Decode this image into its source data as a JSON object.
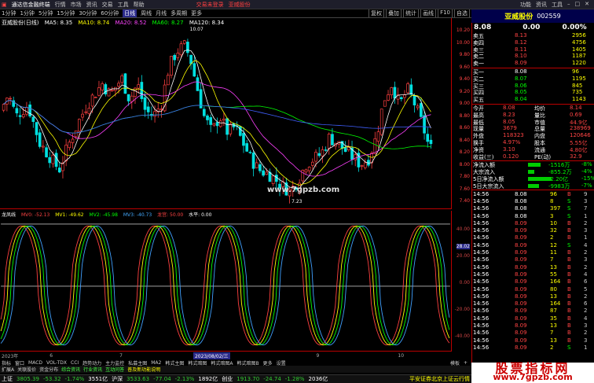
{
  "titlebar": {
    "app": "通达信金融终端",
    "menus": [
      "行情",
      "市场",
      "资讯",
      "交易",
      "工具",
      "帮助"
    ],
    "mid1": "交易未登录",
    "mid2": "亚威股份",
    "right": [
      "功能",
      "资讯",
      "工具"
    ]
  },
  "toolbar": {
    "periods": [
      "1分钟",
      "1分钟",
      "5分钟",
      "15分钟",
      "30分钟",
      "60分钟",
      "日线",
      "周线",
      "月线",
      "多周期",
      "更多"
    ],
    "active": "日线",
    "tools": [
      "复权",
      "叠加",
      "统计",
      "画线",
      "F10",
      "自选"
    ]
  },
  "main_chart": {
    "title": "亚威股份(日线)",
    "ma": [
      {
        "label": "MA5: 8.35",
        "color": "#ffffff"
      },
      {
        "label": "MA10: 8.74",
        "color": "#ffff00"
      },
      {
        "label": "MA20: 8.52",
        "color": "#ff40ff"
      },
      {
        "label": "MA60: 8.27",
        "color": "#00ff00"
      },
      {
        "label": "MA120: 8.34",
        "color": "#ffffff"
      }
    ],
    "price_ticks": [
      "10.20",
      "10.00",
      "9.80",
      "9.60",
      "9.40",
      "9.20",
      "9.00",
      "8.80",
      "8.60",
      "8.40",
      "8.20",
      "8.00",
      "7.80",
      "7.60",
      "7.40"
    ],
    "high_label": "10.07",
    "low_label": "7.23",
    "watermark": "www.7gpzb.com"
  },
  "indicator": {
    "name": "龙凤线",
    "values": [
      {
        "label": "MV0: -52.13",
        "color": "#ff4040"
      },
      {
        "label": "MV1: -49.62",
        "color": "#ffff00"
      },
      {
        "label": "MV2: -45.98",
        "color": "#00ff00"
      },
      {
        "label": "MV3: -40.73",
        "color": "#40a0ff"
      },
      {
        "label": "龙宫: 50.00",
        "color": "#ff4040"
      },
      {
        "label": "水平: 0.00",
        "color": "#ffffff"
      }
    ],
    "axis_ticks": [
      "40.00",
      "20.00",
      "0.00",
      "-20.00",
      "-40.00"
    ],
    "cursor_value": "28.02",
    "date_label": "2023/08/02/三"
  },
  "bottom": {
    "year": "2023年",
    "month_marks": [
      "6",
      "7",
      "8",
      "9",
      "10"
    ],
    "tabs_row1": [
      "指标",
      "窗口",
      "MACD",
      "VOL-TDX",
      "CCI",
      "趋势动力",
      "主力监控",
      "私募主图",
      "MA2",
      "韩式主图",
      "韩式暗图",
      "韩式暗图A",
      "韩式暗图B",
      "更多",
      "设置"
    ],
    "tabs_row2": [
      "扩展A",
      "关联股价",
      "资金分布",
      "综合资讯",
      "行业资讯",
      "互动问答",
      "普及新功能说明"
    ],
    "right_tabs": [
      "模板",
      "+"
    ]
  },
  "statusbar": {
    "items": [
      {
        "name": "上证",
        "value": "3805.39",
        "chg": "-53.32",
        "pct": "-1.74%",
        "vol": "3551亿"
      },
      {
        "name": "沪深",
        "value": "3533.63",
        "chg": "-77.04",
        "pct": "-2.13%",
        "vol": "1892亿"
      },
      {
        "name": "创业",
        "value": "1913.70",
        "chg": "-24.74",
        "pct": "-1.28%",
        "vol": "2036亿"
      }
    ],
    "right": "平安证券北京上证云行情"
  },
  "right_panel": {
    "stock_name": "亚威股份",
    "stock_code": "002559",
    "price": "8.08",
    "change": "0.00",
    "pct": "0.00%",
    "asks": [
      {
        "label": "卖五",
        "price": "8.13",
        "vol": "2956"
      },
      {
        "label": "卖四",
        "price": "8.12",
        "vol": "4756"
      },
      {
        "label": "卖三",
        "price": "8.11",
        "vol": "1405"
      },
      {
        "label": "卖二",
        "price": "8.10",
        "vol": "1187"
      },
      {
        "label": "卖一",
        "price": "8.09",
        "vol": "1220"
      }
    ],
    "bids": [
      {
        "label": "买一",
        "price": "8.08",
        "vol": "96"
      },
      {
        "label": "买二",
        "price": "8.07",
        "vol": "1195"
      },
      {
        "label": "买三",
        "price": "8.06",
        "vol": "845"
      },
      {
        "label": "买四",
        "price": "8.05",
        "vol": "735"
      },
      {
        "label": "买五",
        "price": "8.04",
        "vol": "1143"
      }
    ],
    "stats": [
      {
        "l1": "今开",
        "v1": "8.08",
        "l2": "均价",
        "v2": "8.14"
      },
      {
        "l1": "最高",
        "v1": "8.23",
        "l2": "量比",
        "v2": "0.69"
      },
      {
        "l1": "最低",
        "v1": "8.05",
        "l2": "市值",
        "v2": "44.9亿"
      },
      {
        "l1": "现量",
        "v1": "3679",
        "l2": "总量",
        "v2": "238969"
      },
      {
        "l1": "外盘",
        "v1": "118323",
        "l2": "内盘",
        "v2": "120646"
      },
      {
        "l1": "换手",
        "v1": "4.97%",
        "l2": "股本",
        "v2": "5.55亿"
      },
      {
        "l1": "净资",
        "v1": "3.10",
        "l2": "流通",
        "v2": "4.80亿"
      },
      {
        "l1": "收益(三)",
        "v1": "0.120",
        "l2": "PE(动)",
        "v2": "32.9"
      }
    ],
    "flows": [
      {
        "label": "净流入额",
        "value": "-1516万",
        "pct": "-8%"
      },
      {
        "label": "大宗流入",
        "value": "-855.2万",
        "pct": "-4%"
      },
      {
        "label": "5日净流入额",
        "value": "-2.20亿",
        "pct": "-15%"
      },
      {
        "label": "5日大宗流入",
        "value": "-9983万",
        "pct": "-7%"
      }
    ],
    "trades": [
      {
        "t": "14:56",
        "p": "8.08",
        "v": "96",
        "d": "B",
        "n": "9"
      },
      {
        "t": "14:56",
        "p": "8.08",
        "v": "8",
        "d": "S",
        "n": "3"
      },
      {
        "t": "14:56",
        "p": "8.08",
        "v": "397",
        "d": "S",
        "n": "7"
      },
      {
        "t": "14:56",
        "p": "8.08",
        "v": "3",
        "d": "S",
        "n": "1"
      },
      {
        "t": "14:56",
        "p": "8.09",
        "v": "10",
        "d": "B",
        "n": "2"
      },
      {
        "t": "14:56",
        "p": "8.09",
        "v": "32",
        "d": "B",
        "n": "3"
      },
      {
        "t": "14:56",
        "p": "8.09",
        "v": "2",
        "d": "B",
        "n": "1"
      },
      {
        "t": "14:56",
        "p": "8.09",
        "v": "12",
        "d": "S",
        "n": "4"
      },
      {
        "t": "14:56",
        "p": "8.09",
        "v": "11",
        "d": "B",
        "n": "2"
      },
      {
        "t": "14:56",
        "p": "8.09",
        "v": "7",
        "d": "B",
        "n": "3"
      },
      {
        "t": "14:56",
        "p": "8.09",
        "v": "13",
        "d": "B",
        "n": "2"
      },
      {
        "t": "14:56",
        "p": "8.09",
        "v": "55",
        "d": "B",
        "n": "4"
      },
      {
        "t": "14:56",
        "p": "8.09",
        "v": "164",
        "d": "B",
        "n": "6"
      },
      {
        "t": "14:56",
        "p": "8.09",
        "v": "80",
        "d": "B",
        "n": "5"
      },
      {
        "t": "14:56",
        "p": "8.09",
        "v": "13",
        "d": "B",
        "n": "2"
      },
      {
        "t": "14:56",
        "p": "8.09",
        "v": "164",
        "d": "B",
        "n": "6"
      },
      {
        "t": "14:56",
        "p": "8.09",
        "v": "87",
        "d": "B",
        "n": "2"
      },
      {
        "t": "14:56",
        "p": "8.09",
        "v": "35",
        "d": "B",
        "n": "4"
      },
      {
        "t": "14:56",
        "p": "8.09",
        "v": "13",
        "d": "B",
        "n": "3"
      },
      {
        "t": "14:56",
        "p": "8.09",
        "v": "7",
        "d": "B",
        "n": "2"
      },
      {
        "t": "14:56",
        "p": "8.09",
        "v": "13",
        "d": "B",
        "n": "3"
      },
      {
        "t": "14:56",
        "p": "8.09",
        "v": "2",
        "d": "S",
        "n": "1"
      }
    ],
    "ad_line1": "股票指标网",
    "ad_line2": "www.7gpzb.com"
  }
}
